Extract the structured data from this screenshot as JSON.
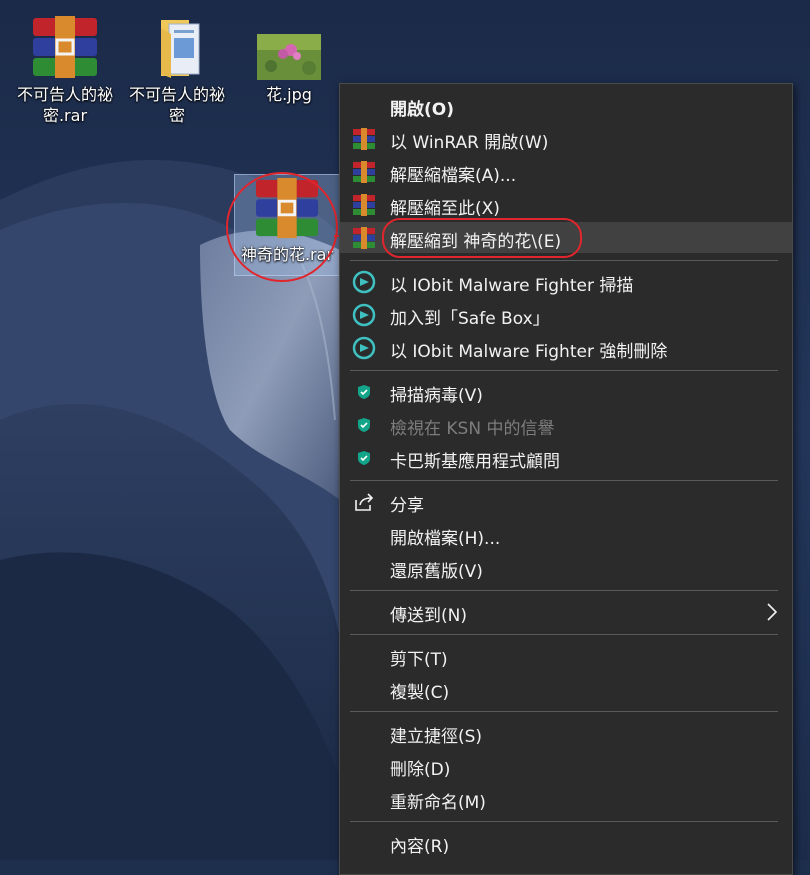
{
  "desktop": {
    "icons": [
      {
        "label": "不可告人的祕密.rar",
        "icon": "winrar-archive-icon"
      },
      {
        "label": "不可告人的祕密",
        "icon": "folder-icon"
      },
      {
        "label": "花.jpg",
        "icon": "image-thumbnail-icon"
      },
      {
        "label": "神奇的花.rar",
        "icon": "winrar-archive-icon"
      }
    ]
  },
  "context_menu": {
    "items": [
      {
        "label": "開啟(O)",
        "icon": ""
      },
      {
        "label": "以 WinRAR 開啟(W)",
        "icon": "winrar-icon"
      },
      {
        "label": "解壓縮檔案(A)...",
        "icon": "winrar-icon"
      },
      {
        "label": "解壓縮至此(X)",
        "icon": "winrar-icon"
      },
      {
        "label": "解壓縮到 神奇的花\\(E)",
        "icon": "winrar-icon"
      },
      {
        "label": "以 IObit Malware Fighter 掃描",
        "icon": "iobit-shield-icon"
      },
      {
        "label": "加入到「Safe Box」",
        "icon": "iobit-shield-icon"
      },
      {
        "label": "以 IObit Malware Fighter 強制刪除",
        "icon": "iobit-shield-icon"
      },
      {
        "label": "掃描病毒(V)",
        "icon": "kaspersky-shield-icon"
      },
      {
        "label": "檢視在 KSN 中的信譽",
        "icon": "kaspersky-shield-icon"
      },
      {
        "label": "卡巴斯基應用程式顧問",
        "icon": "kaspersky-shield-icon"
      },
      {
        "label": "分享",
        "icon": "share-icon"
      },
      {
        "label": "開啟檔案(H)...",
        "icon": ""
      },
      {
        "label": "還原舊版(V)",
        "icon": ""
      },
      {
        "label": "傳送到(N)",
        "icon": "chevron-right-icon"
      },
      {
        "label": "剪下(T)",
        "icon": ""
      },
      {
        "label": "複製(C)",
        "icon": ""
      },
      {
        "label": "建立捷徑(S)",
        "icon": ""
      },
      {
        "label": "刪除(D)",
        "icon": ""
      },
      {
        "label": "重新命名(M)",
        "icon": ""
      },
      {
        "label": "內容(R)",
        "icon": ""
      }
    ]
  },
  "colors": {
    "menu_bg": "#2b2b2b",
    "menu_text": "#f2f2f2",
    "disabled_text": "#7d7d7d",
    "highlight_row": "#414141",
    "annotation_red": "#e0262c"
  }
}
